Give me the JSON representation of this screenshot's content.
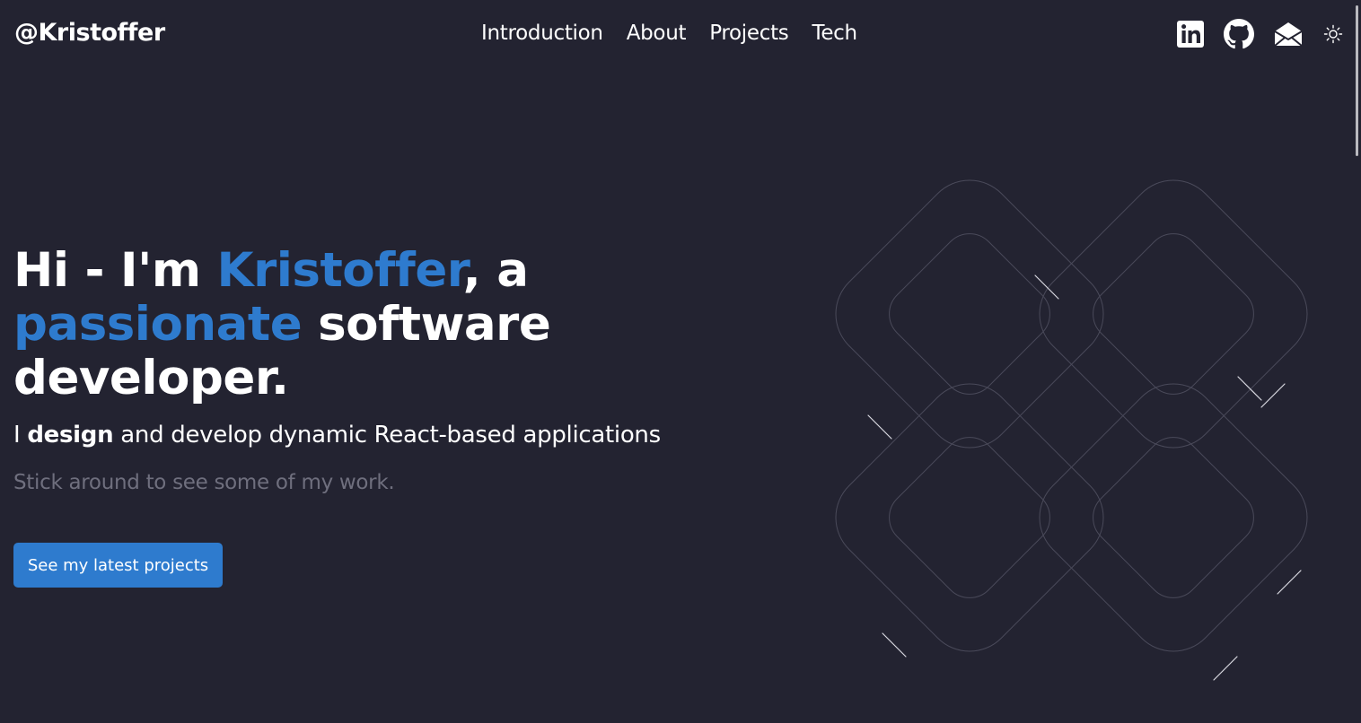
{
  "header": {
    "logo": "@Kristoffer",
    "nav": [
      "Introduction",
      "About",
      "Projects",
      "Tech"
    ],
    "icons": [
      "linkedin-icon",
      "github-icon",
      "mail-icon",
      "theme-toggle-icon"
    ]
  },
  "hero": {
    "title_part1": "Hi - I'm ",
    "title_name": "Kristoffer",
    "title_part2": ", a ",
    "title_accent": "passionate",
    "title_part3": " software developer.",
    "subtitle_prefix": "I ",
    "subtitle_bold": "design",
    "subtitle_rest": " and develop dynamic React-based applications",
    "muted": "Stick around to see some of my work.",
    "cta_label": "See my latest projects"
  },
  "colors": {
    "background": "#232331",
    "accent": "#2e7bce",
    "muted": "#6f6f7e",
    "line": "#4a4a5a"
  }
}
